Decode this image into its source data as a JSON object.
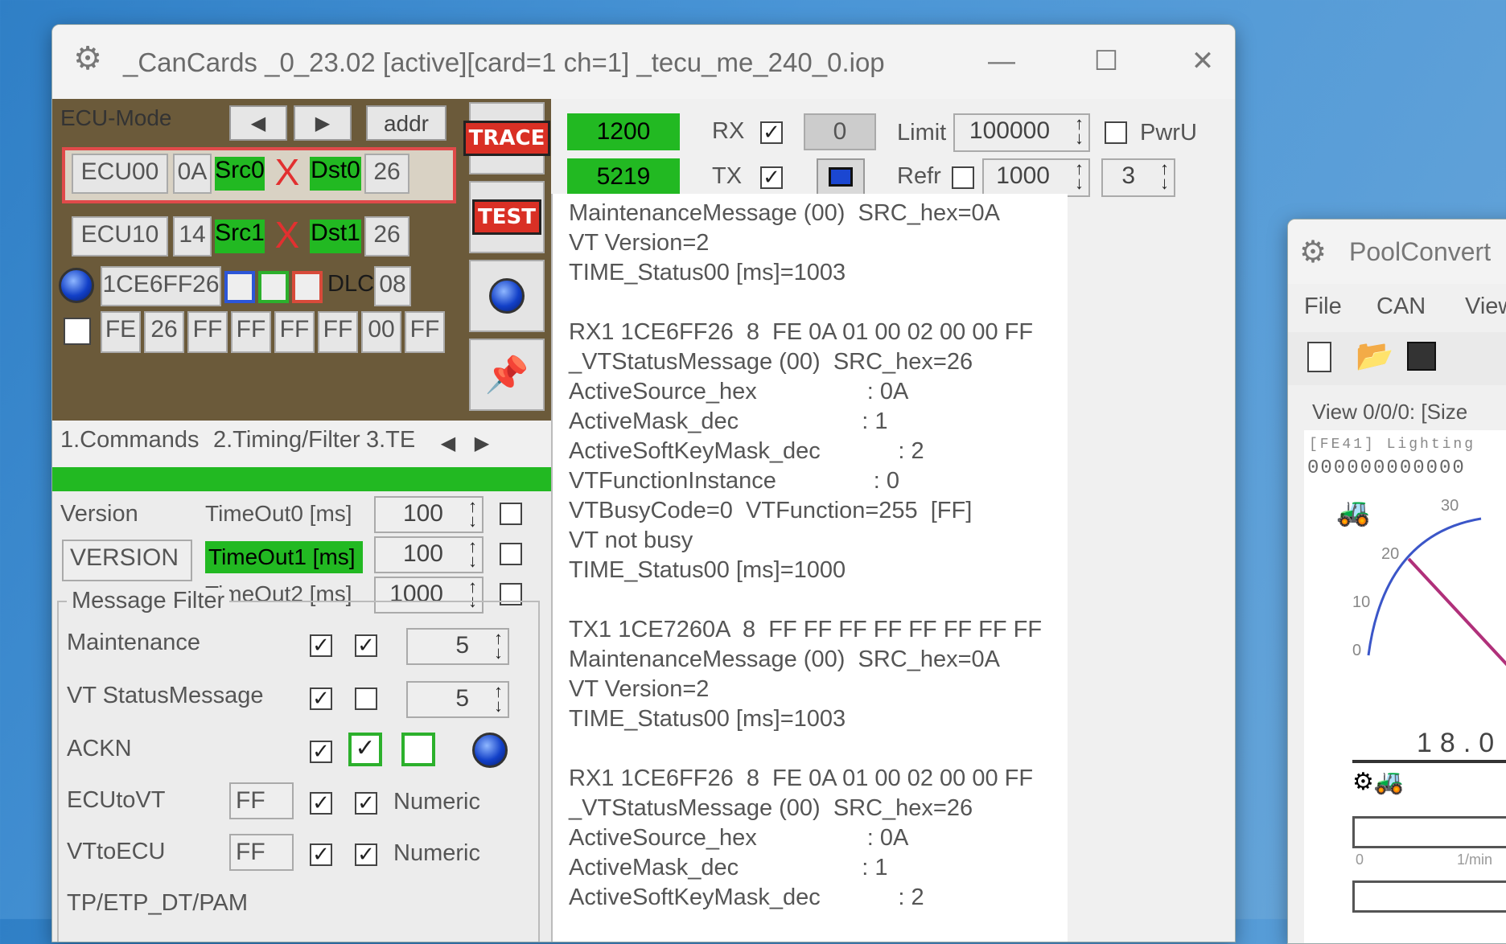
{
  "main_window": {
    "title": "_CanCards _0_23.02  [active][card=1 ch=1] _tecu_me_240_0.iop",
    "minimize": "—",
    "maximize": "☐",
    "close": "✕"
  },
  "ecu_mode": {
    "label": "ECU-Mode",
    "nav_left": "◀",
    "nav_right": "▶",
    "addr_button": "addr",
    "row0": {
      "name": "ECU00",
      "addr": "0A",
      "src": "Src0",
      "x": "X",
      "dst": "Dst0",
      "dst_val": "26"
    },
    "row1": {
      "name": "ECU10",
      "addr": "14",
      "src": "Src1",
      "x": "X",
      "dst": "Dst1",
      "dst_val": "26"
    },
    "can_id": "1CE6FF26",
    "dlc_label": "DLC",
    "dlc_value": "08",
    "data_bytes": [
      "FE",
      "26",
      "FF",
      "FF",
      "FF",
      "FF",
      "00",
      "FF"
    ]
  },
  "tool_buttons": {
    "trace": "TRACE",
    "test": "TEST"
  },
  "counters": {
    "rx_count": "1200",
    "tx_count": "5219"
  },
  "rxtx": {
    "rx_label": "RX",
    "tx_label": "TX",
    "rx_checked": true,
    "tx_checked": true,
    "rx_value": "0",
    "limit_label": "Limit",
    "limit_value": "100000",
    "pwr_label": "PwrU",
    "refr_label": "Refr",
    "refr_value": "1000",
    "refr_small": "3"
  },
  "tabs": [
    "1.Commands",
    "2.Timing/Filter",
    "3.TE"
  ],
  "timing": {
    "version_label": "Version",
    "version_value": "VERSION",
    "timeouts": [
      {
        "label": "TimeOut0 [ms]",
        "value": "100",
        "highlight": false
      },
      {
        "label": "TimeOut1 [ms]",
        "value": "100",
        "highlight": true
      },
      {
        "label": "TimeOut2 [ms]",
        "value": "1000",
        "highlight": false
      }
    ]
  },
  "message_filter": {
    "title": "Message Filter",
    "rows": [
      {
        "label": "Maintenance",
        "value": "5"
      },
      {
        "label": "VT StatusMessage",
        "value": "5"
      },
      {
        "label": "ACKN"
      },
      {
        "label": "ECUtoVT",
        "field": "FF",
        "mode": "Numeric"
      },
      {
        "label": "VTtoECU",
        "field": "FF",
        "mode": "Numeric"
      },
      {
        "label": "TP/ETP_DT/PAM"
      }
    ]
  },
  "log_lines": [
    "MaintenanceMessage (00)  SRC_hex=0A",
    "VT Version=2",
    "TIME_Status00 [ms]=1003",
    "",
    "RX1 1CE6FF26  8  FE 0A 01 00 02 00 00 FF",
    "_VTStatusMessage (00)  SRC_hex=26",
    "ActiveSource_hex                 : 0A",
    "ActiveMask_dec                   : 1",
    "ActiveSoftKeyMask_dec            : 2",
    "VTFunctionInstance               : 0",
    "VTBusyCode=0  VTFunction=255  [FF]",
    "VT not busy",
    "TIME_Status00 [ms]=1000",
    "",
    "TX1 1CE7260A  8  FF FF FF FF FF FF FF FF",
    "MaintenanceMessage (00)  SRC_hex=0A",
    "VT Version=2",
    "TIME_Status00 [ms]=1003",
    "",
    "RX1 1CE6FF26  8  FE 0A 01 00 02 00 00 FF",
    "_VTStatusMessage (00)  SRC_hex=26",
    "ActiveSource_hex                 : 0A",
    "ActiveMask_dec                   : 1",
    "ActiveSoftKeyMask_dec            : 2"
  ],
  "pool_window": {
    "title": "PoolConvert",
    "menu": [
      "File",
      "CAN",
      "View"
    ],
    "view_label": "View 0/0/0: [Size",
    "header_text": "[FE41]  Lighting",
    "digits": "000000000000",
    "gauge_labels": [
      "30",
      "20",
      "10",
      "0"
    ],
    "big_readout": "18.0",
    "rpm_unit": "1/min",
    "rpm_zero": "0"
  },
  "colors": {
    "green": "#22b922",
    "panel": "#6b5a3a",
    "red_border": "#e04a4a"
  }
}
